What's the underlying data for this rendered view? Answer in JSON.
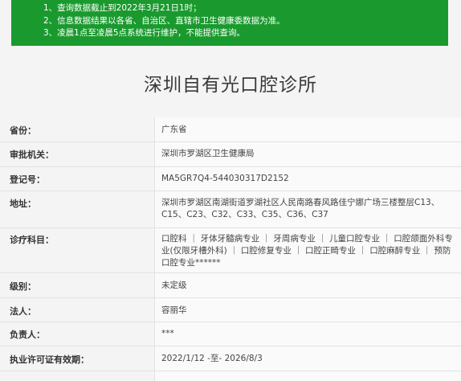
{
  "notice": {
    "lines": [
      "1、查询数据截止到2022年3月21日1时；",
      "2、信息数据结果以各省、自治区、直辖市卫生健康委数据为准。",
      "3、凌晨1点至凌晨5点系统进行维护，不能提供查询。"
    ],
    "bg_color": "#1a9a2e"
  },
  "title": "深圳自有光口腔诊所",
  "fields": [
    {
      "label": "省份：",
      "value": "广东省"
    },
    {
      "label": "审批机关：",
      "value": "深圳市罗湖区卫生健康局"
    },
    {
      "label": "登记号：",
      "value": "MA5GR7Q4-544030317D2152"
    },
    {
      "label": "地址：",
      "value": "深圳市罗湖区南湖街道罗湖社区人民南路春风路佳宁娜广场三楼整层C13、C15、C23、C32、C33、C35、C36、C37"
    },
    {
      "label": "诊疗科目：",
      "value": "口腔科 ｜ 牙体牙髓病专业 ｜ 牙周病专业 ｜ 儿童口腔专业 ｜ 口腔颌面外科专业(仅限牙槽外科) ｜ 口腔修复专业 ｜ 口腔正畸专业 ｜ 口腔麻醉专业 ｜ 预防口腔专业******"
    },
    {
      "label": "级别：",
      "value": "未定级"
    },
    {
      "label": "法人：",
      "value": "容丽华"
    },
    {
      "label": "负责人：",
      "value": "***"
    },
    {
      "label": "执业许可证有效期：",
      "value": "2022/1/12 -至- 2026/8/3"
    }
  ]
}
